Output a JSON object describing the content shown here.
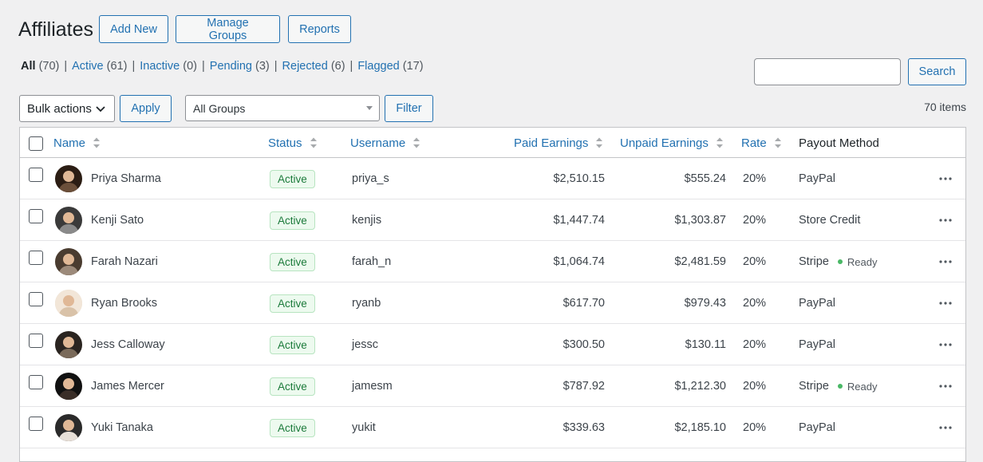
{
  "page": {
    "title": "Affiliates",
    "add_new": "Add New",
    "manage_groups": "Manage Groups",
    "reports": "Reports"
  },
  "filters": [
    {
      "label": "All",
      "count": "(70)",
      "current": true
    },
    {
      "label": "Active",
      "count": "(61)",
      "current": false
    },
    {
      "label": "Inactive",
      "count": "(0)",
      "current": false
    },
    {
      "label": "Pending",
      "count": "(3)",
      "current": false
    },
    {
      "label": "Rejected",
      "count": "(6)",
      "current": false
    },
    {
      "label": "Flagged",
      "count": "(17)",
      "current": false
    }
  ],
  "search": {
    "value": "",
    "button": "Search"
  },
  "toolbar": {
    "bulk_actions": "Bulk actions",
    "apply": "Apply",
    "group_select": "All Groups",
    "filter": "Filter",
    "items_count": "70 items"
  },
  "columns": {
    "name": "Name",
    "status": "Status",
    "username": "Username",
    "paid": "Paid Earnings",
    "unpaid": "Unpaid Earnings",
    "rate": "Rate",
    "payout": "Payout Method"
  },
  "rows": [
    {
      "name": "Priya Sharma",
      "status": "Active",
      "username": "priya_s",
      "paid": "$2,510.15",
      "unpaid": "$555.24",
      "rate": "20%",
      "payout": "PayPal",
      "ready": ""
    },
    {
      "name": "Kenji Sato",
      "status": "Active",
      "username": "kenjis",
      "paid": "$1,447.74",
      "unpaid": "$1,303.87",
      "rate": "20%",
      "payout": "Store Credit",
      "ready": ""
    },
    {
      "name": "Farah Nazari",
      "status": "Active",
      "username": "farah_n",
      "paid": "$1,064.74",
      "unpaid": "$2,481.59",
      "rate": "20%",
      "payout": "Stripe",
      "ready": "Ready"
    },
    {
      "name": "Ryan Brooks",
      "status": "Active",
      "username": "ryanb",
      "paid": "$617.70",
      "unpaid": "$979.43",
      "rate": "20%",
      "payout": "PayPal",
      "ready": ""
    },
    {
      "name": "Jess Calloway",
      "status": "Active",
      "username": "jessc",
      "paid": "$300.50",
      "unpaid": "$130.11",
      "rate": "20%",
      "payout": "PayPal",
      "ready": ""
    },
    {
      "name": "James Mercer",
      "status": "Active",
      "username": "jamesm",
      "paid": "$787.92",
      "unpaid": "$1,212.30",
      "rate": "20%",
      "payout": "Stripe",
      "ready": "Ready"
    },
    {
      "name": "Yuki Tanaka",
      "status": "Active",
      "username": "yukit",
      "paid": "$339.63",
      "unpaid": "$2,185.10",
      "rate": "20%",
      "payout": "PayPal",
      "ready": ""
    }
  ],
  "colors": {
    "accent": "#2271b1",
    "badge_bg": "#edfaef",
    "badge_text": "#1b7a3a",
    "ready_dot": "#4ab866"
  }
}
